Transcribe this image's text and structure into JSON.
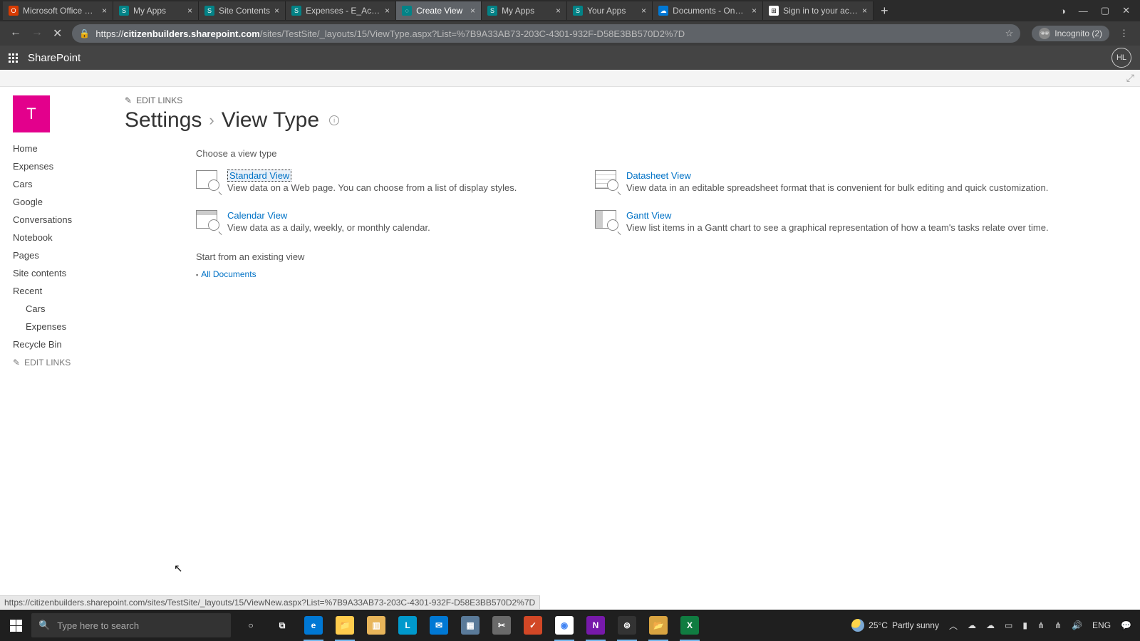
{
  "browser": {
    "tabs": [
      {
        "title": "Microsoft Office Home",
        "favcolor": "#d83b01"
      },
      {
        "title": "My Apps",
        "favcolor": "#038387"
      },
      {
        "title": "Site Contents",
        "favcolor": "#038387"
      },
      {
        "title": "Expenses - E_Account…",
        "favcolor": "#038387"
      },
      {
        "title": "Create View",
        "favcolor": "#038387",
        "active": true
      },
      {
        "title": "My Apps",
        "favcolor": "#038387"
      },
      {
        "title": "Your Apps",
        "favcolor": "#038387"
      },
      {
        "title": "Documents - OneDriv…",
        "favcolor": "#0078d4"
      },
      {
        "title": "Sign in to your accoun…",
        "favcolor": "#00a4ef"
      }
    ],
    "url_host": "citizenbuilders.sharepoint.com",
    "url_rest": "/sites/TestSite/_layouts/15/ViewType.aspx?List=%7B9A33AB73-203C-4301-932F-D58E3BB570D2%7D",
    "incognito_label": "Incognito (2)"
  },
  "suite": {
    "product": "SharePoint",
    "user_initials": "HL"
  },
  "header": {
    "edit_links_label": "EDIT LINKS",
    "site_logo_letter": "T",
    "breadcrumb_settings": "Settings",
    "breadcrumb_sep": "›",
    "breadcrumb_current": "View Type"
  },
  "quicklaunch": {
    "items": [
      "Home",
      "Expenses",
      "Cars",
      "Google",
      "Conversations",
      "Notebook",
      "Pages",
      "Site contents",
      "Recent"
    ],
    "sub_items": [
      "Cars",
      "Expenses"
    ],
    "tail": "Recycle Bin",
    "edit_links": "EDIT LINKS"
  },
  "content": {
    "choose_label": "Choose a view type",
    "options": {
      "standard": {
        "title": "Standard View",
        "desc": "View data on a Web page. You can choose from a list of display styles."
      },
      "datasheet": {
        "title": "Datasheet View",
        "desc": "View data in an editable spreadsheet format that is convenient for bulk editing and quick customization."
      },
      "calendar": {
        "title": "Calendar View",
        "desc": "View data as a daily, weekly, or monthly calendar."
      },
      "gantt": {
        "title": "Gantt View",
        "desc": "View list items in a Gantt chart to see a graphical representation of how a team's tasks relate over time."
      }
    },
    "existing_label": "Start from an existing view",
    "existing_item": "All Documents"
  },
  "status_url": "https://citizenbuilders.sharepoint.com/sites/TestSite/_layouts/15/ViewNew.aspx?List=%7B9A33AB73-203C-4301-932F-D58E3BB570D2%7D",
  "taskbar": {
    "search_placeholder": "Type here to search",
    "weather_temp": "25°C",
    "weather_text": "Partly sunny",
    "lang": "ENG",
    "apps": [
      {
        "label": "○",
        "bg": "transparent",
        "txt": "#fff"
      },
      {
        "label": "⧉",
        "bg": "transparent",
        "txt": "#fff"
      },
      {
        "label": "e",
        "bg": "#0078d4"
      },
      {
        "label": "📁",
        "bg": "#ffcc4d"
      },
      {
        "label": "🗂",
        "bg": "#e8b55a"
      },
      {
        "label": "L",
        "bg": "#0099cc"
      },
      {
        "label": "✉",
        "bg": "#0078d4"
      },
      {
        "label": "▦",
        "bg": "#5a7a99"
      },
      {
        "label": "✂",
        "bg": "#6a6a6a"
      },
      {
        "label": "T",
        "bg": "#d24726"
      },
      {
        "label": "©",
        "bg": "linear-gradient(135deg,#ea4335,#fbbc05,#34a853,#4285f4)",
        "active": true
      },
      {
        "label": "N",
        "bg": "#7719aa",
        "active": true
      },
      {
        "label": "⊚",
        "bg": "#333",
        "active": true
      },
      {
        "label": "📂",
        "bg": "#d9a441",
        "active": true
      },
      {
        "label": "X",
        "bg": "#107c41",
        "active": true
      }
    ]
  }
}
